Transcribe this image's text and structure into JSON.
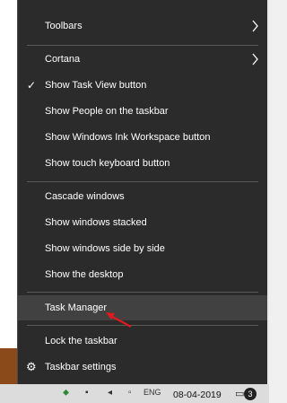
{
  "menu": {
    "items": [
      {
        "label": "Toolbars",
        "submenu": true
      },
      {
        "label": "Cortana",
        "submenu": true
      },
      {
        "label": "Show Task View button",
        "checked": true
      },
      {
        "label": "Show People on the taskbar"
      },
      {
        "label": "Show Windows Ink Workspace button"
      },
      {
        "label": "Show touch keyboard button"
      },
      {
        "label": "Cascade windows"
      },
      {
        "label": "Show windows stacked"
      },
      {
        "label": "Show windows side by side"
      },
      {
        "label": "Show the desktop"
      },
      {
        "label": "Task Manager",
        "highlighted": true
      },
      {
        "label": "Lock the taskbar"
      },
      {
        "label": "Taskbar settings",
        "icon": "gear-icon"
      }
    ]
  },
  "taskbar": {
    "date": "08-04-2019",
    "language": "ENG",
    "notification_count": "3"
  },
  "colors": {
    "menu_bg": "#2b2b2b",
    "highlight_bg": "#414141",
    "separator": "#5a5a5a",
    "annotation_arrow": "#e0191b"
  }
}
